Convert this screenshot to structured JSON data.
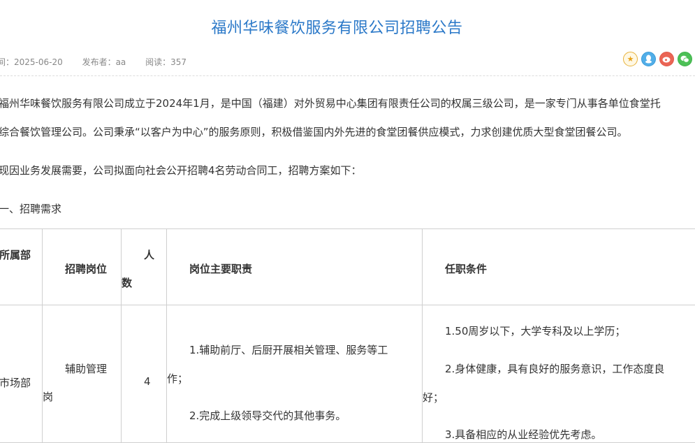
{
  "page": {
    "title": "福州华味餐饮服务有限公司招聘公告",
    "meta": {
      "date": "间：2025-06-20",
      "publisher": "发布者：aa",
      "views": "阅读：357"
    },
    "share_icons": [
      "favorite-star-icon",
      "qq-icon",
      "weibo-icon",
      "wechat-icon"
    ],
    "accent_color": "#2a78c8"
  },
  "content": {
    "para1_line1": "福州华味餐饮服务有限公司成立于2024年1月，是中国（福建）对外贸易中心集团有限责任公司的权属三级公司，是一家专门从事各单位食堂托",
    "para1_line2": "综合餐饮管理公司。公司秉承“以客户为中心”的服务原则，积极借鉴国内外先进的食堂团餐供应模式，力求创建优质大型食堂团餐公司。",
    "para2": "现因业务发展需要，公司拟面向社会公开招聘4名劳动合同工，招聘方案如下：",
    "section1": "一、招聘需求"
  },
  "table": {
    "headers": {
      "dept": "所属部",
      "position": "招聘岗位",
      "count_a": "人",
      "count_b": "数",
      "duties": "岗位主要职责",
      "requirements": "任职条件"
    },
    "row": {
      "dept": "市场部",
      "position_a": "辅助管理",
      "position_b": "岗",
      "count": "4",
      "duty1_a": "1.辅助前厅、后厨开展相关管理、服务等工",
      "duty1_b": "作；",
      "duty2": "2.完成上级领导交代的其他事务。",
      "req1": "1.50周岁以下，大学专科及以上学历；",
      "req2_a": "2.身体健康，具有良好的服务意识，工作态度良",
      "req2_b": "好；",
      "req3": "3.具备相应的从业经验优先考虑。"
    }
  }
}
